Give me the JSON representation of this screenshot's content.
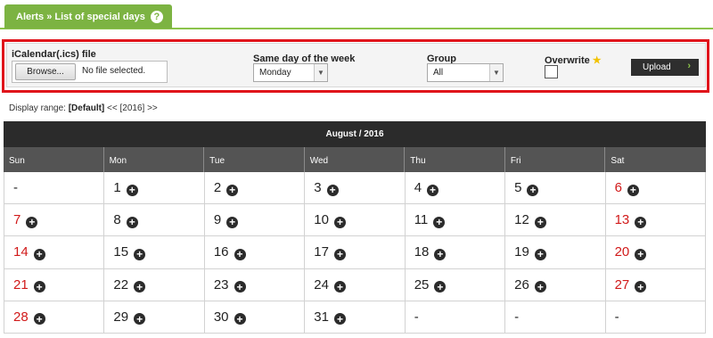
{
  "tab": {
    "label": "Alerts » List of special days",
    "help": "?"
  },
  "form": {
    "ical_label": "iCalendar(.ics) file",
    "browse_label": "Browse...",
    "file_status": "No file selected.",
    "same_day_label": "Same day of the week",
    "same_day_value": "Monday",
    "group_label": "Group",
    "group_value": "All",
    "overwrite_label": "Overwrite",
    "overwrite_star": "★",
    "overwrite_checked": false,
    "upload_label": "Upload",
    "upload_icon": "›"
  },
  "range": {
    "prefix": "Display range:",
    "default": "[Default]",
    "nav": "<< [2016] >>"
  },
  "calendar": {
    "title": "August / 2016",
    "weekdays": [
      "Sun",
      "Mon",
      "Tue",
      "Wed",
      "Thu",
      "Fri",
      "Sat"
    ],
    "weeks": [
      [
        {
          "day": "-"
        },
        {
          "day": "1",
          "add": true
        },
        {
          "day": "2",
          "add": true
        },
        {
          "day": "3",
          "add": true
        },
        {
          "day": "4",
          "add": true
        },
        {
          "day": "5",
          "add": true
        },
        {
          "day": "6",
          "add": true,
          "red": true
        }
      ],
      [
        {
          "day": "7",
          "add": true,
          "red": true
        },
        {
          "day": "8",
          "add": true
        },
        {
          "day": "9",
          "add": true
        },
        {
          "day": "10",
          "add": true
        },
        {
          "day": "11",
          "add": true
        },
        {
          "day": "12",
          "add": true
        },
        {
          "day": "13",
          "add": true,
          "red": true
        }
      ],
      [
        {
          "day": "14",
          "add": true,
          "red": true
        },
        {
          "day": "15",
          "add": true
        },
        {
          "day": "16",
          "add": true
        },
        {
          "day": "17",
          "add": true
        },
        {
          "day": "18",
          "add": true
        },
        {
          "day": "19",
          "add": true
        },
        {
          "day": "20",
          "add": true,
          "red": true
        }
      ],
      [
        {
          "day": "21",
          "add": true,
          "red": true
        },
        {
          "day": "22",
          "add": true
        },
        {
          "day": "23",
          "add": true
        },
        {
          "day": "24",
          "add": true
        },
        {
          "day": "25",
          "add": true
        },
        {
          "day": "26",
          "add": true
        },
        {
          "day": "27",
          "add": true,
          "red": true
        }
      ],
      [
        {
          "day": "28",
          "add": true,
          "red": true
        },
        {
          "day": "29",
          "add": true
        },
        {
          "day": "30",
          "add": true
        },
        {
          "day": "31",
          "add": true
        },
        {
          "day": "-"
        },
        {
          "day": "-"
        },
        {
          "day": "-"
        }
      ]
    ],
    "add_glyph": "+"
  },
  "colors": {
    "accent": "#7cb342",
    "highlight": "#e0141b",
    "weekend": "#d11a1a",
    "header_dark": "#2b2b2b",
    "header_mid": "#545454"
  }
}
